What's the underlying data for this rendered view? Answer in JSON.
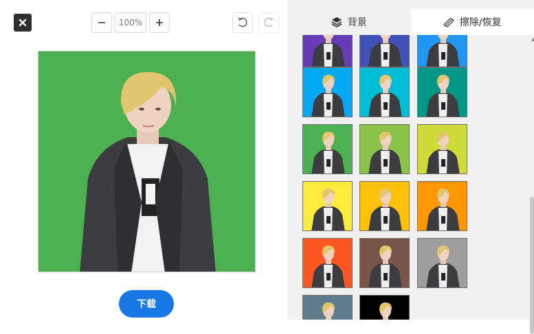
{
  "toolbar": {
    "close_icon": "close-icon",
    "zoom_out_icon": "minus-icon",
    "zoom_level": "100%",
    "zoom_in_icon": "plus-icon",
    "undo_icon": "undo-icon",
    "redo_icon": "redo-icon"
  },
  "preview": {
    "background_color": "#4caf50"
  },
  "download_label": "下载",
  "tabs": [
    {
      "label": "背景",
      "icon": "layers-icon",
      "active": true
    },
    {
      "label": "擦除/恢复",
      "icon": "eraser-icon",
      "active": false
    }
  ],
  "swatches": [
    {
      "color": "#673ab7"
    },
    {
      "color": "#3f51b5"
    },
    {
      "color": "#2196f3"
    },
    {
      "color": "#03a9f4"
    },
    {
      "color": "#00bcd4"
    },
    {
      "color": "#009688"
    },
    {
      "color": "#4caf50"
    },
    {
      "color": "#8bc34a"
    },
    {
      "color": "#cddc39"
    },
    {
      "color": "#ffeb3b"
    },
    {
      "color": "#ffc107"
    },
    {
      "color": "#ff9800"
    },
    {
      "color": "#ff5722"
    },
    {
      "color": "#795548"
    },
    {
      "color": "#9e9e9e"
    },
    {
      "color": "#607d8b"
    },
    {
      "color": "#000000"
    }
  ]
}
